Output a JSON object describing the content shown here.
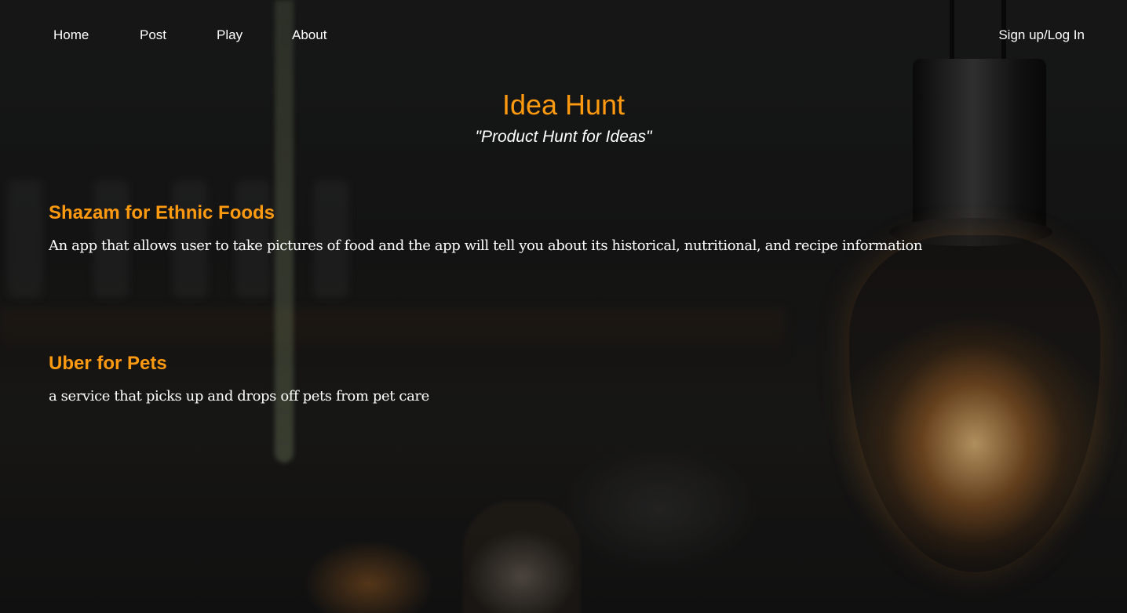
{
  "nav": {
    "home_label": "Home",
    "post_label": "Post",
    "play_label": "Play",
    "about_label": "About",
    "auth_label": "Sign up/Log In"
  },
  "hero": {
    "title": "Idea Hunt",
    "tagline": "\"Product Hunt for Ideas\""
  },
  "ideas": [
    {
      "title": "Shazam for Ethnic Foods",
      "description": "An app that allows user to take pictures of food and the app will tell you about its historical, nutritional, and recipe information"
    },
    {
      "title": "Uber for Pets",
      "description": "a service that picks up and drops off pets from pet care"
    }
  ],
  "colors": {
    "accent": "#ff9a10",
    "text": "#ffffff",
    "background": "#151515"
  }
}
